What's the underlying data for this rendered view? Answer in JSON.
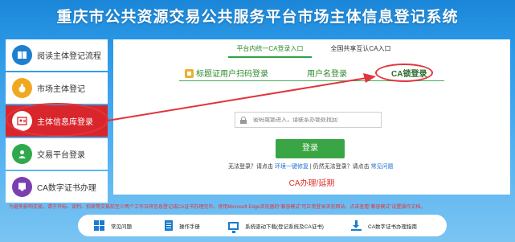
{
  "title": "重庆市公共资源交易公共服务平台市场主体信息登记系统",
  "menu": {
    "items": [
      {
        "label": "阅读主体登记流程",
        "icon": "book-icon"
      },
      {
        "label": "市场主体登记",
        "icon": "money-bag-icon"
      },
      {
        "label": "主体信息库登录",
        "icon": "id-card-icon",
        "active": true
      },
      {
        "label": "交易平台登录",
        "icon": "user-icon"
      },
      {
        "label": "CA数字证书办理",
        "icon": "certificate-icon"
      }
    ]
  },
  "top_tabs": {
    "internal": "平台内统一CA登录入口",
    "national": "全国共享互认CA入口"
  },
  "sub_tabs": {
    "qr": "标题证用户扫码登录",
    "username": "用户名登录",
    "ca": "CA锁登录"
  },
  "password": {
    "placeholder": "密码或锁进入，请联系办锁处找回"
  },
  "login_button": "登录",
  "help": {
    "forgot_prefix": "无法登录？请点击",
    "repair_link": "环境一键修复",
    "separator": " | 仍然无法登录？请点击",
    "faq_link": "常见问题"
  },
  "ca_handle": "CA办理/延期",
  "notice": "为避免影响交易，请于开标、谈判、拍卖等交易前至少两个工作日将信息登记或CA证书办理完毕。使用Microsoft Edge浏览器的“兼容模式”可正常登录浏览网站，点击查看“兼容模式”设置操作文档。",
  "bottom_bar": {
    "items": [
      {
        "label": "常见问题",
        "icon": "grid-icon"
      },
      {
        "label": "操作手册",
        "icon": "document-icon"
      },
      {
        "label": "系统驱动下载(登记系统及CA证书)",
        "icon": "monitor-icon"
      },
      {
        "label": "CA数字证书办理指南",
        "icon": "download-icon"
      }
    ]
  },
  "colors": {
    "header_blue": "#1b86d8",
    "active_red": "#d9252c",
    "login_green": "#3aa545",
    "annotation_red": "#e0353c",
    "link_blue": "#1a6fd0"
  }
}
